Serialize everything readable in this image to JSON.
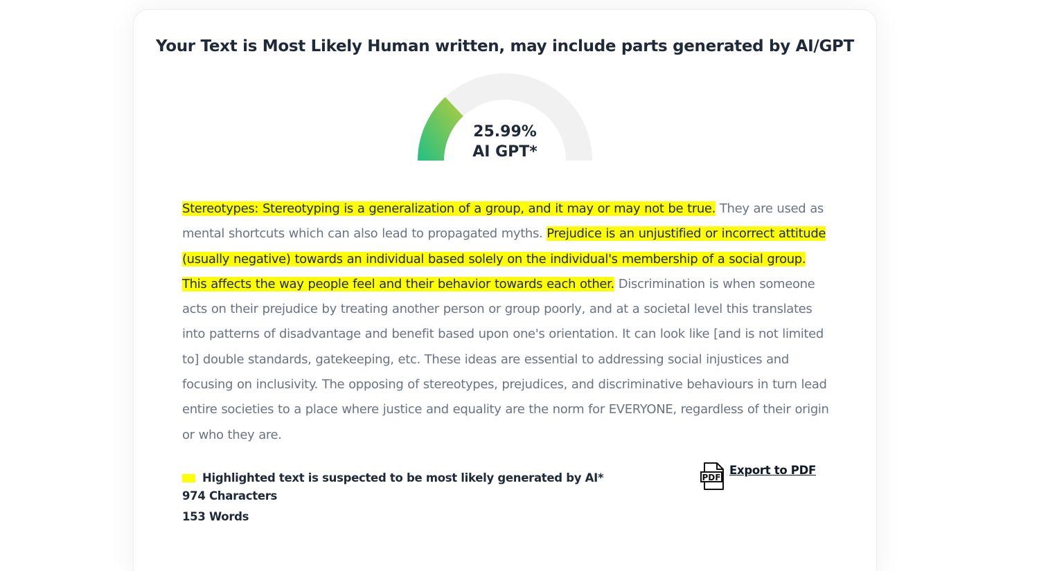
{
  "result": {
    "title": "Your Text is Most Likely Human written, may include parts generated by AI/GPT"
  },
  "gauge": {
    "value": 25.99,
    "value_text": "25.99%",
    "label": "AI GPT*",
    "track_color": "#f1f1f1",
    "fill_start_color": "#22c084",
    "fill_end_color": "#b4cc3c"
  },
  "analyzed_text": {
    "highlight_color": "#ffff00",
    "segments": [
      {
        "text": "Stereotypes: Stereotyping is a generalization of a group, and it may or may not be true.",
        "highlighted": true
      },
      {
        "text": " They are used as mental shortcuts which can also lead to propagated myths. ",
        "highlighted": false
      },
      {
        "text": "Prejudice is an unjustified or incorrect attitude (usually negative) towards an individual based solely on the individual's membership of a social group.",
        "highlighted": true
      },
      {
        "text": " ",
        "highlighted": false
      },
      {
        "text": "This affects the way people feel and their behavior towards each other.",
        "highlighted": true
      },
      {
        "text": " Discrimination is when someone acts on their prejudice by treating another person or group poorly, and at a societal level this translates into patterns of disadvantage and benefit based upon one's orientation. It can look like [and is not limited to] double standards, gatekeeping, etc. These ideas are essential to addressing social injustices and focusing on inclusivity. The opposing of stereotypes, prejudices, and discriminative behaviours in turn lead entire societies to a place where justice and equality are the norm for EVERYONE, regardless of their origin or who they are.",
        "highlighted": false
      }
    ]
  },
  "legend": {
    "highlight_note": "Highlighted text is suspected to be most likely generated by AI*"
  },
  "stats": {
    "characters": "974 Characters",
    "words": "153 Words"
  },
  "export": {
    "label": "Export to PDF",
    "icon": "pdf-file-icon",
    "icon_text": "PDF"
  }
}
